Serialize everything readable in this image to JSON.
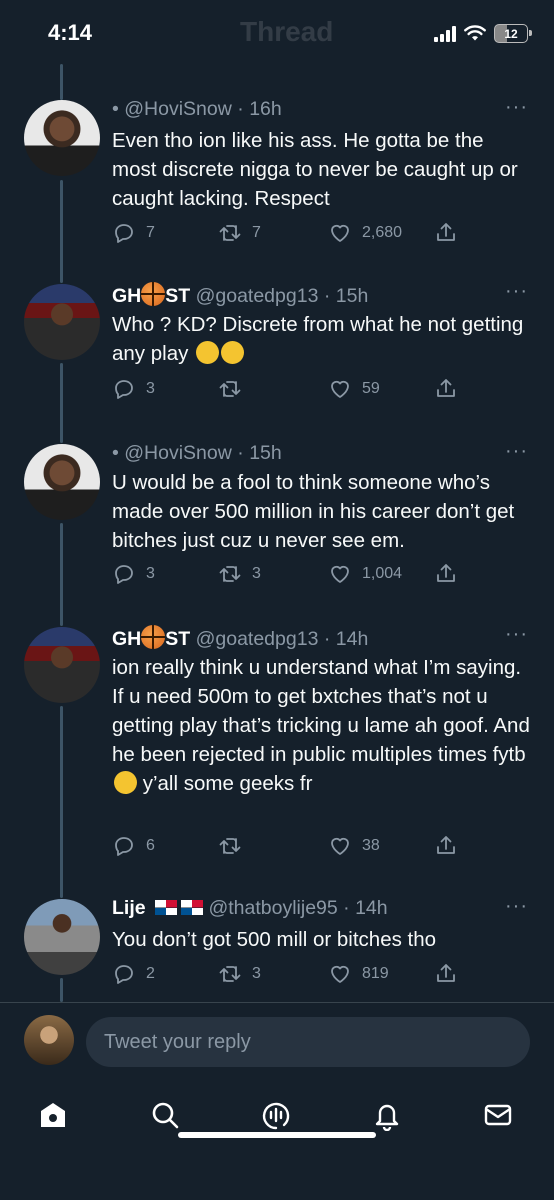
{
  "status": {
    "time": "4:14",
    "battery": "12",
    "header_title": "Thread"
  },
  "tweets": [
    {
      "name": "",
      "handle": "@HoviSnow",
      "time": "16h",
      "text": "Even tho ion like his ass. He gotta be the most discrete nigga to never be caught up or caught lacking. Respect",
      "replies": "7",
      "retweets": "7",
      "likes": "2,680"
    },
    {
      "name_prefix": "GH",
      "name_suffix": "ST",
      "handle": "@goatedpg13",
      "time": "15h",
      "text": "Who ? KD? Discrete from what he not getting any play",
      "replies": "3",
      "retweets": "",
      "likes": "59"
    },
    {
      "name": "",
      "handle": "@HoviSnow",
      "time": "15h",
      "text": "U would be a fool to think someone who’s made over 500 million in his career don’t get bitches just cuz u never see em.",
      "replies": "3",
      "retweets": "3",
      "likes": "1,004"
    },
    {
      "name_prefix": "GH",
      "name_suffix": "ST",
      "handle": "@goatedpg13",
      "time": "14h",
      "text_a": "ion really think u understand what I’m saying. If u need 500m to get bxtches that’s not u getting play that’s tricking u lame ah goof. And he been rejected in public multiples times fytb",
      "text_b": "y’all some geeks fr",
      "replies": "6",
      "retweets": "",
      "likes": "38"
    },
    {
      "name": "Lije",
      "handle": "@thatboylije95",
      "time": "14h",
      "text": "You don’t got 500 mill or bitches tho",
      "replies": "2",
      "retweets": "3",
      "likes": "819"
    }
  ],
  "reply_bar": {
    "placeholder": "Tweet your reply"
  },
  "nav": [
    "home-icon",
    "search-icon",
    "spaces-icon",
    "notifications-icon",
    "messages-icon"
  ],
  "colors": {
    "background": "#15202b",
    "secondary_text": "#8b98a5",
    "input_bg": "#273340"
  }
}
